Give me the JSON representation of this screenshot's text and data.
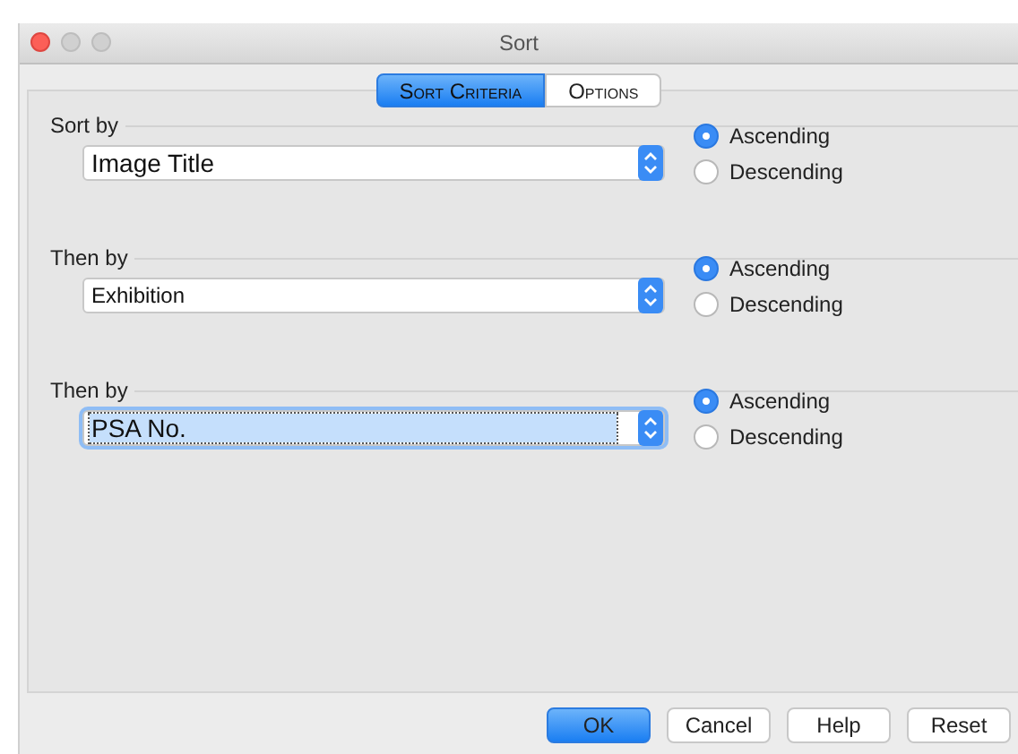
{
  "window": {
    "title": "Sort"
  },
  "tabs": [
    {
      "label": "Sort Criteria",
      "selected": true
    },
    {
      "label": "Options",
      "selected": false
    }
  ],
  "criteria": [
    {
      "label": "Sort by",
      "field": "Image Title",
      "focused": false,
      "large": true,
      "orders": [
        {
          "label": "Ascending",
          "selected": true
        },
        {
          "label": "Descending",
          "selected": false
        }
      ]
    },
    {
      "label": "Then by",
      "field": "Exhibition",
      "focused": false,
      "large": false,
      "orders": [
        {
          "label": "Ascending",
          "selected": true
        },
        {
          "label": "Descending",
          "selected": false
        }
      ]
    },
    {
      "label": "Then by",
      "field": "PSA No.",
      "focused": true,
      "large": true,
      "orders": [
        {
          "label": "Ascending",
          "selected": true
        },
        {
          "label": "Descending",
          "selected": false
        }
      ]
    }
  ],
  "buttons": [
    {
      "label": "OK",
      "default": true
    },
    {
      "label": "Cancel",
      "default": false
    },
    {
      "label": "Help",
      "default": false
    },
    {
      "label": "Reset",
      "default": false
    }
  ]
}
